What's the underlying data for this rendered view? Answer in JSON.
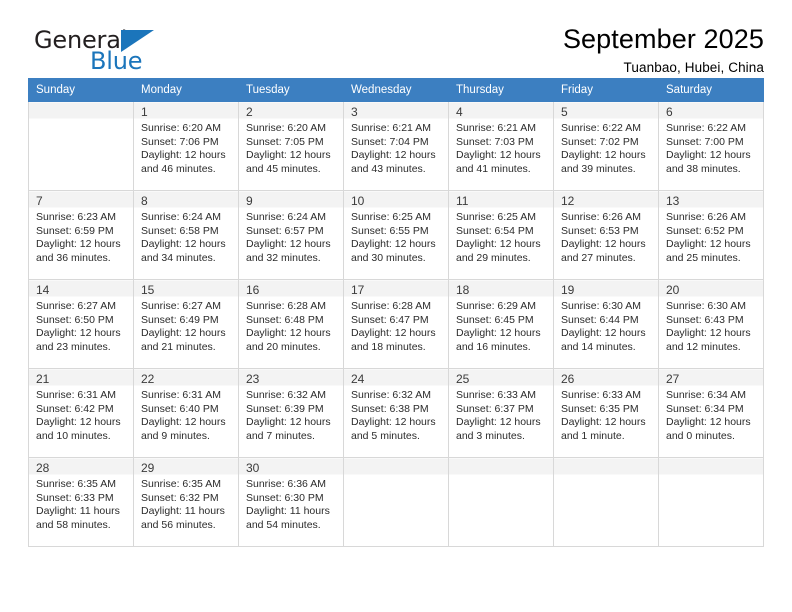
{
  "brand": {
    "name_top": "General",
    "name_bottom": "Blue",
    "triangle_icon": "triangle-icon",
    "accent_color": "#1b75bb"
  },
  "header": {
    "title": "September 2025",
    "subtitle": "Tuanbao, Hubei, China"
  },
  "calendar": {
    "header_bg": "#3c7fc1",
    "weekday_headers": [
      "Sunday",
      "Monday",
      "Tuesday",
      "Wednesday",
      "Thursday",
      "Friday",
      "Saturday"
    ],
    "weeks": [
      [
        {
          "day": "",
          "info": ""
        },
        {
          "day": "1",
          "info": "Sunrise: 6:20 AM\nSunset: 7:06 PM\nDaylight: 12 hours\nand 46 minutes."
        },
        {
          "day": "2",
          "info": "Sunrise: 6:20 AM\nSunset: 7:05 PM\nDaylight: 12 hours\nand 45 minutes."
        },
        {
          "day": "3",
          "info": "Sunrise: 6:21 AM\nSunset: 7:04 PM\nDaylight: 12 hours\nand 43 minutes."
        },
        {
          "day": "4",
          "info": "Sunrise: 6:21 AM\nSunset: 7:03 PM\nDaylight: 12 hours\nand 41 minutes."
        },
        {
          "day": "5",
          "info": "Sunrise: 6:22 AM\nSunset: 7:02 PM\nDaylight: 12 hours\nand 39 minutes."
        },
        {
          "day": "6",
          "info": "Sunrise: 6:22 AM\nSunset: 7:00 PM\nDaylight: 12 hours\nand 38 minutes."
        }
      ],
      [
        {
          "day": "7",
          "info": "Sunrise: 6:23 AM\nSunset: 6:59 PM\nDaylight: 12 hours\nand 36 minutes."
        },
        {
          "day": "8",
          "info": "Sunrise: 6:24 AM\nSunset: 6:58 PM\nDaylight: 12 hours\nand 34 minutes."
        },
        {
          "day": "9",
          "info": "Sunrise: 6:24 AM\nSunset: 6:57 PM\nDaylight: 12 hours\nand 32 minutes."
        },
        {
          "day": "10",
          "info": "Sunrise: 6:25 AM\nSunset: 6:55 PM\nDaylight: 12 hours\nand 30 minutes."
        },
        {
          "day": "11",
          "info": "Sunrise: 6:25 AM\nSunset: 6:54 PM\nDaylight: 12 hours\nand 29 minutes."
        },
        {
          "day": "12",
          "info": "Sunrise: 6:26 AM\nSunset: 6:53 PM\nDaylight: 12 hours\nand 27 minutes."
        },
        {
          "day": "13",
          "info": "Sunrise: 6:26 AM\nSunset: 6:52 PM\nDaylight: 12 hours\nand 25 minutes."
        }
      ],
      [
        {
          "day": "14",
          "info": "Sunrise: 6:27 AM\nSunset: 6:50 PM\nDaylight: 12 hours\nand 23 minutes."
        },
        {
          "day": "15",
          "info": "Sunrise: 6:27 AM\nSunset: 6:49 PM\nDaylight: 12 hours\nand 21 minutes."
        },
        {
          "day": "16",
          "info": "Sunrise: 6:28 AM\nSunset: 6:48 PM\nDaylight: 12 hours\nand 20 minutes."
        },
        {
          "day": "17",
          "info": "Sunrise: 6:28 AM\nSunset: 6:47 PM\nDaylight: 12 hours\nand 18 minutes."
        },
        {
          "day": "18",
          "info": "Sunrise: 6:29 AM\nSunset: 6:45 PM\nDaylight: 12 hours\nand 16 minutes."
        },
        {
          "day": "19",
          "info": "Sunrise: 6:30 AM\nSunset: 6:44 PM\nDaylight: 12 hours\nand 14 minutes."
        },
        {
          "day": "20",
          "info": "Sunrise: 6:30 AM\nSunset: 6:43 PM\nDaylight: 12 hours\nand 12 minutes."
        }
      ],
      [
        {
          "day": "21",
          "info": "Sunrise: 6:31 AM\nSunset: 6:42 PM\nDaylight: 12 hours\nand 10 minutes."
        },
        {
          "day": "22",
          "info": "Sunrise: 6:31 AM\nSunset: 6:40 PM\nDaylight: 12 hours\nand 9 minutes."
        },
        {
          "day": "23",
          "info": "Sunrise: 6:32 AM\nSunset: 6:39 PM\nDaylight: 12 hours\nand 7 minutes."
        },
        {
          "day": "24",
          "info": "Sunrise: 6:32 AM\nSunset: 6:38 PM\nDaylight: 12 hours\nand 5 minutes."
        },
        {
          "day": "25",
          "info": "Sunrise: 6:33 AM\nSunset: 6:37 PM\nDaylight: 12 hours\nand 3 minutes."
        },
        {
          "day": "26",
          "info": "Sunrise: 6:33 AM\nSunset: 6:35 PM\nDaylight: 12 hours\nand 1 minute."
        },
        {
          "day": "27",
          "info": "Sunrise: 6:34 AM\nSunset: 6:34 PM\nDaylight: 12 hours\nand 0 minutes."
        }
      ],
      [
        {
          "day": "28",
          "info": "Sunrise: 6:35 AM\nSunset: 6:33 PM\nDaylight: 11 hours\nand 58 minutes."
        },
        {
          "day": "29",
          "info": "Sunrise: 6:35 AM\nSunset: 6:32 PM\nDaylight: 11 hours\nand 56 minutes."
        },
        {
          "day": "30",
          "info": "Sunrise: 6:36 AM\nSunset: 6:30 PM\nDaylight: 11 hours\nand 54 minutes."
        },
        {
          "day": "",
          "info": ""
        },
        {
          "day": "",
          "info": ""
        },
        {
          "day": "",
          "info": ""
        },
        {
          "day": "",
          "info": ""
        }
      ]
    ]
  }
}
